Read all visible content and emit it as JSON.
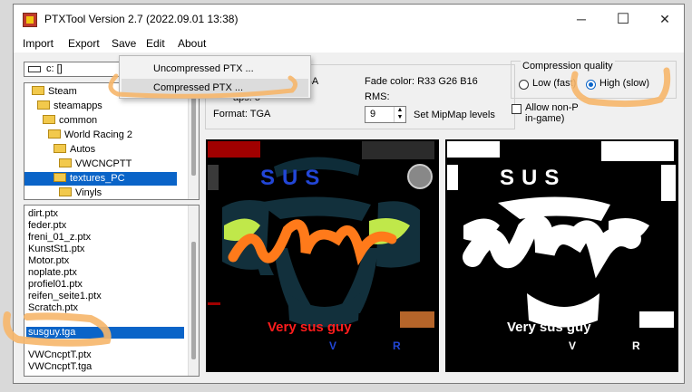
{
  "window": {
    "title": "PTXTool Version 2.7 (2022.09.01 13:38)",
    "minimize": "─",
    "maximize": "☐",
    "close": "✕"
  },
  "menu": {
    "import": "Import",
    "export": "Export",
    "save": "Save",
    "edit": "Edit",
    "about": "About"
  },
  "save_menu": {
    "uncompressed": "Uncompressed PTX ...",
    "compressed": "Compressed PTX ..."
  },
  "drive": {
    "value": "c: []"
  },
  "tree": [
    "Steam",
    "steamapps",
    "common",
    "World Racing 2",
    "Autos",
    "VWCNCPTT",
    "textures_PC",
    "Vinyls"
  ],
  "files": [
    "dirt.ptx",
    "feder.ptx",
    "freni_01_z.ptx",
    "KunstSt1.ptx",
    "Motor.ptx",
    "noplate.ptx",
    "profiel01.ptx",
    "reifen_seite1.ptx",
    "Scratch.ptx",
    "susguy.tga",
    "VWCncptT.ptx",
    "VWCncptT.tga"
  ],
  "info": {
    "format_partial": "GBA",
    "mipmaps_partial": "aps: 5",
    "format_label": "Format: TGA",
    "fade_label": "Fade color:",
    "fade_r": "R33",
    "fade_g": "G26",
    "fade_b": "B16",
    "rms": "RMS:",
    "mipmap_value": "9",
    "mipmap_levels": "Set MipMap levels"
  },
  "compression": {
    "title": "Compression quality",
    "low": "Low (fast)",
    "high": "High (slow)",
    "selected": "high"
  },
  "allow": {
    "line1": "Allow non-P",
    "line2": "in-game)"
  },
  "texture": {
    "text_sus": "SUS",
    "text_caption": "Very sus guy",
    "letter_v": "V",
    "letter_r": "R"
  },
  "colors": {
    "accent": "#0a64c8",
    "highlight_stroke": "#f6b66a"
  }
}
